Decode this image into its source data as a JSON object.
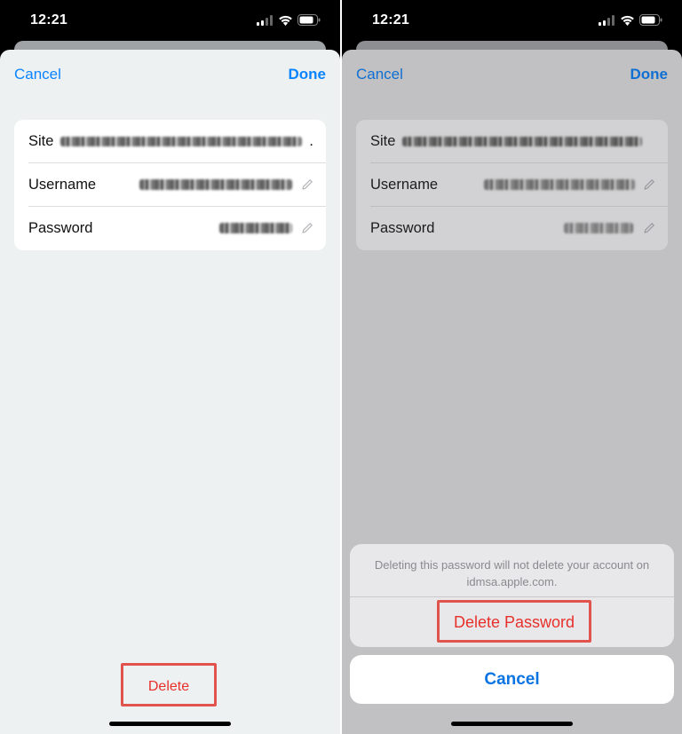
{
  "left": {
    "status": {
      "time": "12:21"
    },
    "nav": {
      "cancel": "Cancel",
      "done": "Done"
    },
    "form": {
      "site_label": "Site",
      "site_ellipsis": ".",
      "username_label": "Username",
      "password_label": "Password"
    },
    "delete_label": "Delete"
  },
  "right": {
    "status": {
      "time": "12:21"
    },
    "nav": {
      "cancel": "Cancel",
      "done": "Done"
    },
    "form": {
      "site_label": "Site",
      "username_label": "Username",
      "password_label": "Password"
    },
    "action_sheet": {
      "message_line1": "Deleting this password will not delete your account on",
      "message_line2": "idmsa.apple.com.",
      "delete_password": "Delete Password",
      "cancel": "Cancel"
    }
  },
  "icons": [
    "cellular-icon",
    "wifi-icon",
    "battery-icon",
    "pencil-icon"
  ],
  "colors": {
    "accent": "#0a84ff",
    "destructive": "#e8302b",
    "highlight": "#e0544d"
  }
}
